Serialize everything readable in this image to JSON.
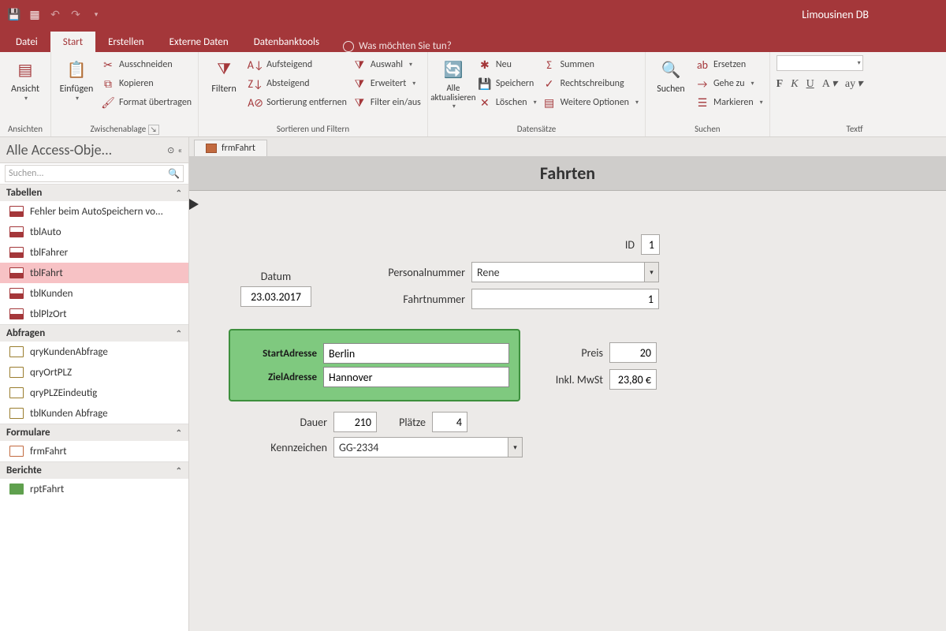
{
  "app": {
    "title": "Limousinen DB"
  },
  "qat": {
    "save": "save",
    "grid": "grid",
    "undo": "undo",
    "redo": "redo"
  },
  "menu": {
    "file": "Datei",
    "start": "Start",
    "create": "Erstellen",
    "external": "Externe Daten",
    "dbtools": "Datenbanktools",
    "tellme": "Was möchten Sie tun?"
  },
  "ribbon": {
    "views_group": "Ansichten",
    "views_btn": "Ansicht",
    "clipboard_group": "Zwischenablage",
    "paste_btn": "Einfügen",
    "cut": "Ausschneiden",
    "copy": "Kopieren",
    "fmtpainter": "Format übertragen",
    "sortfilter_group": "Sortieren und Filtern",
    "filter_btn": "Filtern",
    "asc": "Aufsteigend",
    "desc": "Absteigend",
    "remove_sort": "Sortierung entfernen",
    "selection": "Auswahl",
    "advanced": "Erweitert",
    "toggle_filter": "Filter ein/aus",
    "records_group": "Datensätze",
    "refresh_btn": "Alle aktualisieren",
    "new": "Neu",
    "save": "Speichern",
    "delete": "Löschen",
    "totals": "Summen",
    "spelling": "Rechtschreibung",
    "more": "Weitere Optionen",
    "find_group": "Suchen",
    "find_btn": "Suchen",
    "replace": "Ersetzen",
    "goto": "Gehe zu",
    "select": "Markieren",
    "textfmt_group": "Textf"
  },
  "nav": {
    "header": "Alle Access-Obje...",
    "search_placeholder": "Suchen...",
    "sec_tables": "Tabellen",
    "sec_queries": "Abfragen",
    "sec_forms": "Formulare",
    "sec_reports": "Berichte",
    "tables": [
      "Fehler beim AutoSpeichern vo...",
      "tblAuto",
      "tblFahrer",
      "tblFahrt",
      "tblKunden",
      "tblPlzOrt"
    ],
    "queries": [
      "qryKundenAbfrage",
      "qryOrtPLZ",
      "qryPLZEindeutig",
      "tblKunden Abfrage"
    ],
    "forms": [
      "frmFahrt"
    ],
    "reports": [
      "rptFahrt"
    ]
  },
  "doc": {
    "tab": "frmFahrt"
  },
  "form": {
    "title": "Fahrten",
    "labels": {
      "id": "ID",
      "datum": "Datum",
      "personalnummer": "Personalnummer",
      "fahrtnummer": "Fahrtnummer",
      "startadresse": "StartAdresse",
      "zieladresse": "ZielAdresse",
      "preis": "Preis",
      "inklmwst": "Inkl. MwSt",
      "dauer": "Dauer",
      "plaetze": "Plätze",
      "kennzeichen": "Kennzeichen"
    },
    "values": {
      "id": "1",
      "datum": "23.03.2017",
      "personalnummer": "Rene",
      "fahrtnummer": "1",
      "startadresse": "Berlin",
      "zieladresse": "Hannover",
      "preis": "20",
      "inklmwst": "23,80 €",
      "dauer": "210",
      "plaetze": "4",
      "kennzeichen": "GG-2334"
    }
  }
}
